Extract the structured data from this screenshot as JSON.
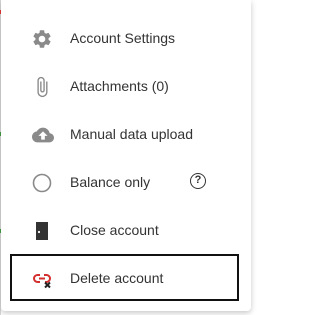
{
  "menu": {
    "items": [
      {
        "label": "Account Settings",
        "icon": "gear-icon"
      },
      {
        "label": "Attachments (0)",
        "icon": "paperclip-icon"
      },
      {
        "label": "Manual data upload",
        "icon": "cloud-upload-icon"
      },
      {
        "label": "Balance only",
        "icon": "radio-circle-icon",
        "help": "?"
      },
      {
        "label": "Close account",
        "icon": "door-icon"
      },
      {
        "label": "Delete account",
        "icon": "unlink-icon"
      }
    ]
  },
  "colors": {
    "icon_gray": "#8a8a8a",
    "text": "#333333",
    "delete_red": "#d32f2f",
    "door_dark": "#333333"
  }
}
